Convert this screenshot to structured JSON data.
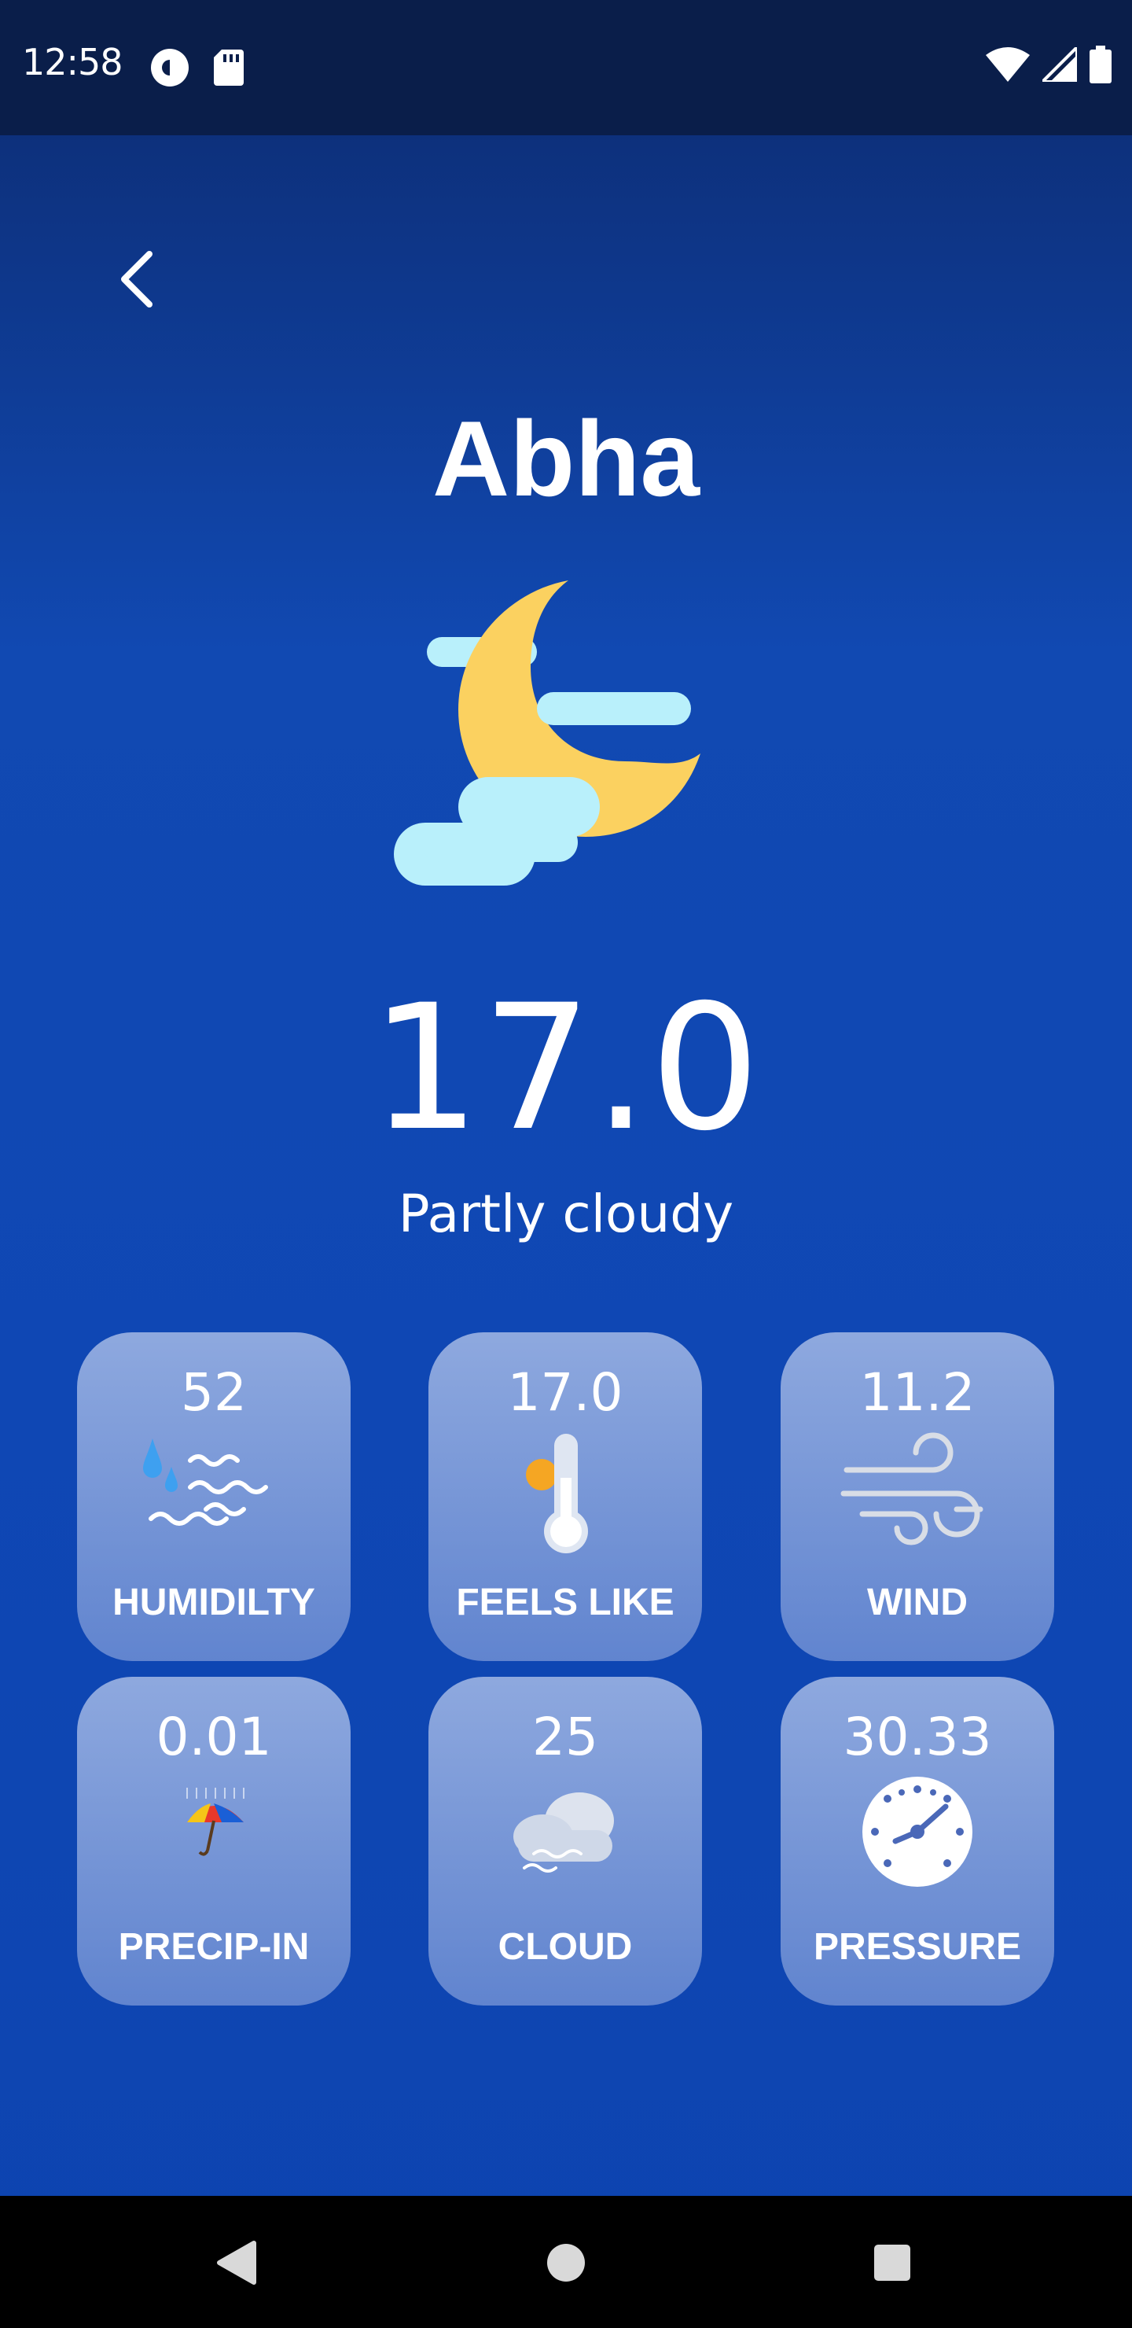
{
  "status_bar": {
    "time": "12:58",
    "left_icons": [
      "pocket-casts-icon",
      "sd-card-icon"
    ],
    "right_icons": [
      "wifi-icon",
      "signal-icon",
      "battery-icon"
    ]
  },
  "header": {
    "back_icon": "chevron-left-icon"
  },
  "location": {
    "city": "Abha"
  },
  "current": {
    "icon": "moon-cloud-icon",
    "temperature": "17.0",
    "condition": "Partly cloudy"
  },
  "tiles": [
    {
      "value": "52",
      "label": "HUMIDILTY",
      "icon": "humidity-icon"
    },
    {
      "value": "17.0",
      "label": "FEELS LIKE",
      "icon": "thermometer-icon"
    },
    {
      "value": "11.2",
      "label": "WIND",
      "icon": "wind-icon"
    },
    {
      "value": "0.01",
      "label": "PRECIP-IN",
      "icon": "umbrella-rain-icon"
    },
    {
      "value": "25",
      "label": "CLOUD",
      "icon": "cloud-fog-icon"
    },
    {
      "value": "30.33",
      "label": "PRESSURE",
      "icon": "pressure-gauge-icon"
    }
  ],
  "colors": {
    "background_top": "#0c2a6e",
    "background_mid": "#1149b2",
    "moon": "#fbd160",
    "cloud": "#b9f0fb",
    "tile": "#9cb2e4"
  },
  "nav_bar": {
    "icons": [
      "back-triangle-icon",
      "home-circle-icon",
      "recents-square-icon"
    ]
  }
}
